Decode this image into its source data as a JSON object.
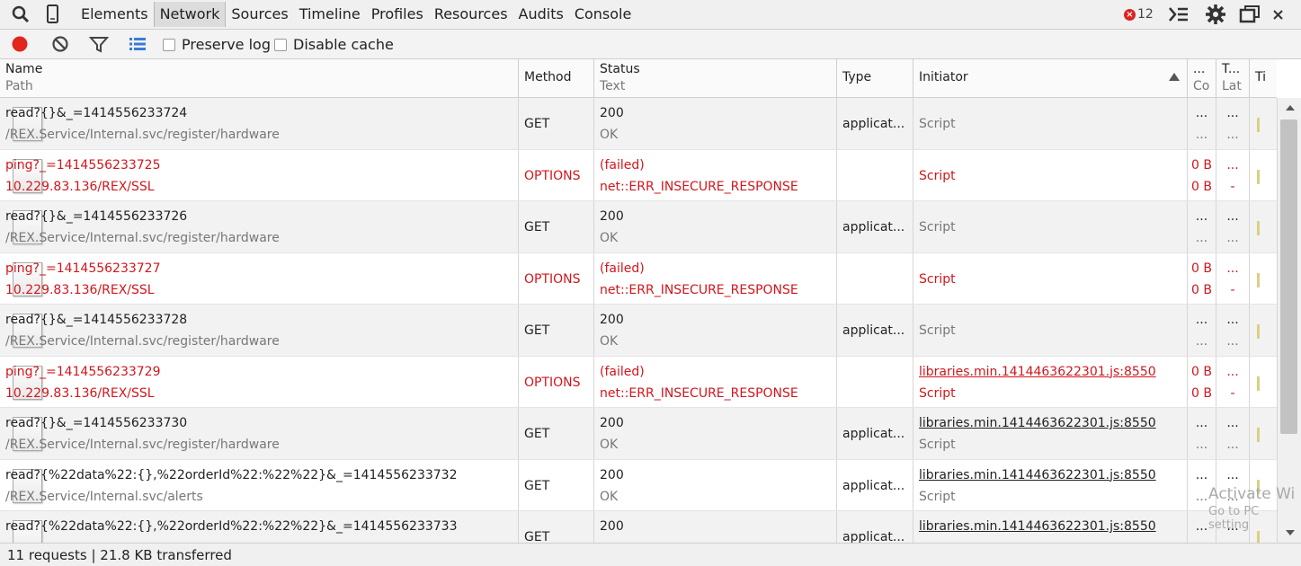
{
  "toolbar": {
    "tabs": [
      "Elements",
      "Network",
      "Sources",
      "Timeline",
      "Profiles",
      "Resources",
      "Audits",
      "Console"
    ],
    "error_count": "12"
  },
  "controls": {
    "preserve_log": "Preserve log",
    "disable_cache": "Disable cache"
  },
  "columns": {
    "name": "Name",
    "path": "Path",
    "method": "Method",
    "status": "Status",
    "text": "Text",
    "type": "Type",
    "initiator": "Initiator",
    "size_top": "...",
    "size_bottom": "Co",
    "time_top": "T...",
    "time_bottom": "Lat",
    "timeline": "Ti"
  },
  "requests": [
    {
      "name": "read?{}&_=1414556233724",
      "path": "/REX.Service/Internal.svc/register/hardware",
      "method": "GET",
      "status": "200",
      "status_text": "OK",
      "type": "applicat...",
      "initiator1": "Script",
      "initiator2": "",
      "size1": "...",
      "size2": "...",
      "time1": "...",
      "time2": "...",
      "failed": false
    },
    {
      "name": "ping?_=1414556233725",
      "path": "10.229.83.136/REX/SSL",
      "method": "OPTIONS",
      "status": "(failed)",
      "status_text": "net::ERR_INSECURE_RESPONSE",
      "type": "",
      "initiator1": "Script",
      "initiator2": "",
      "size1": "0 B",
      "size2": "0 B",
      "time1": "...",
      "time2": "-",
      "failed": true
    },
    {
      "name": "read?{}&_=1414556233726",
      "path": "/REX.Service/Internal.svc/register/hardware",
      "method": "GET",
      "status": "200",
      "status_text": "OK",
      "type": "applicat...",
      "initiator1": "Script",
      "initiator2": "",
      "size1": "...",
      "size2": "...",
      "time1": "...",
      "time2": "...",
      "failed": false
    },
    {
      "name": "ping?_=1414556233727",
      "path": "10.229.83.136/REX/SSL",
      "method": "OPTIONS",
      "status": "(failed)",
      "status_text": "net::ERR_INSECURE_RESPONSE",
      "type": "",
      "initiator1": "Script",
      "initiator2": "",
      "size1": "0 B",
      "size2": "0 B",
      "time1": "...",
      "time2": "-",
      "failed": true
    },
    {
      "name": "read?{}&_=1414556233728",
      "path": "/REX.Service/Internal.svc/register/hardware",
      "method": "GET",
      "status": "200",
      "status_text": "OK",
      "type": "applicat...",
      "initiator1": "Script",
      "initiator2": "",
      "size1": "...",
      "size2": "...",
      "time1": "...",
      "time2": "...",
      "failed": false
    },
    {
      "name": "ping?_=1414556233729",
      "path": "10.229.83.136/REX/SSL",
      "method": "OPTIONS",
      "status": "(failed)",
      "status_text": "net::ERR_INSECURE_RESPONSE",
      "type": "",
      "initiator1": "libraries.min.1414463622301.js:8550",
      "initiator2": "Script",
      "size1": "0 B",
      "size2": "0 B",
      "time1": "...",
      "time2": "-",
      "failed": true
    },
    {
      "name": "read?{}&_=1414556233730",
      "path": "/REX.Service/Internal.svc/register/hardware",
      "method": "GET",
      "status": "200",
      "status_text": "OK",
      "type": "applicat...",
      "initiator1": "libraries.min.1414463622301.js:8550",
      "initiator2": "Script",
      "size1": "...",
      "size2": "...",
      "time1": "...",
      "time2": "...",
      "failed": false
    },
    {
      "name": "read?{%22data%22:{},%22orderId%22:%22%22}&_=1414556233732",
      "path": "/REX.Service/Internal.svc/alerts",
      "method": "GET",
      "status": "200",
      "status_text": "OK",
      "type": "applicat...",
      "initiator1": "libraries.min.1414463622301.js:8550",
      "initiator2": "Script",
      "size1": "...",
      "size2": "...",
      "time1": "...",
      "time2": "...",
      "failed": false
    },
    {
      "name": "read?{%22data%22:{},%22orderId%22:%22%22}&_=1414556233733",
      "path": "",
      "method": "GET",
      "status": "200",
      "status_text": "",
      "type": "applicat...",
      "initiator1": "libraries.min.1414463622301.js:8550",
      "initiator2": "",
      "size1": "...",
      "size2": "",
      "time1": "...",
      "time2": "",
      "failed": false
    }
  ],
  "statusbar": {
    "summary": "11 requests | 21.8 KB transferred"
  },
  "watermark": {
    "line1": "Activate Wi",
    "line2": "Go to PC setting"
  }
}
